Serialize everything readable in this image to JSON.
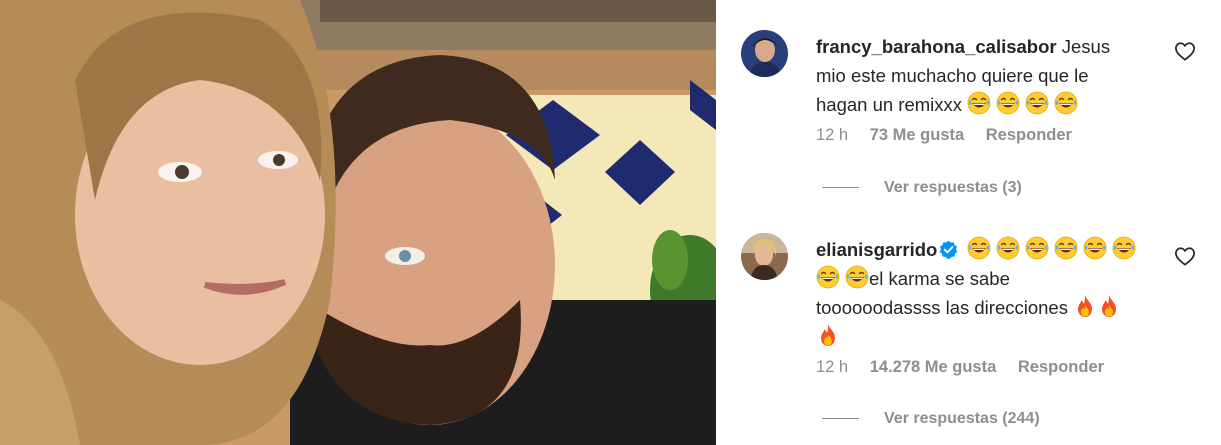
{
  "comments": [
    {
      "username": "francy_barahona_calisabor",
      "verified": false,
      "text_line1": "Jesus",
      "text_line2": "mio este muchacho quiere que le",
      "text_line3": "hagan un remixxx",
      "time": "12 h",
      "likes": "73 Me gusta",
      "reply_label": "Responder",
      "view_replies": "Ver respuestas (3)"
    },
    {
      "username": "elianisgarrido",
      "verified": true,
      "text_line2": "el karma se sabe",
      "text_line3": "toooooodassss las direcciones",
      "time": "12 h",
      "likes": "14.278 Me gusta",
      "reply_label": "Responder",
      "view_replies": "Ver respuestas (244)"
    }
  ],
  "icons": {
    "like": "heart-outline-icon",
    "laugh": "grinning-sweat-emoji",
    "fire": "fire-emoji",
    "verified": "verified-badge-icon"
  },
  "colors": {
    "text": "#262626",
    "meta": "#8e8e8e",
    "verified": "#0095f6"
  }
}
